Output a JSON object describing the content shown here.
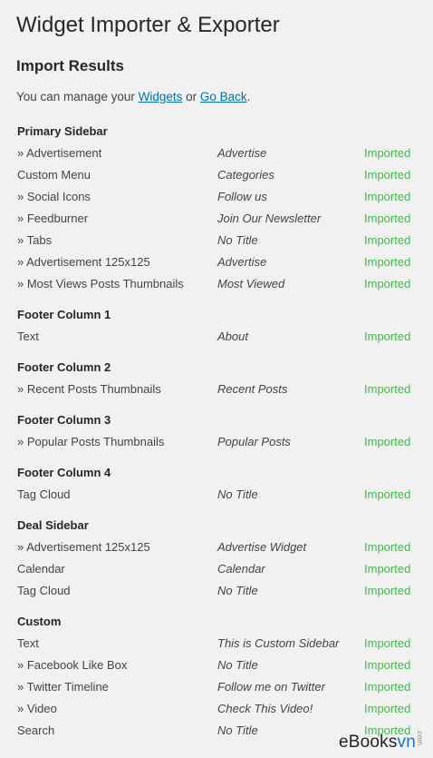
{
  "page": {
    "title": "Widget Importer & Exporter",
    "subtitle": "Import Results",
    "intro_prefix": "You can manage your ",
    "widgets_link": "Widgets",
    "intro_middle": " or ",
    "go_back_link": "Go Back",
    "intro_suffix": "."
  },
  "sections": [
    {
      "title": "Primary Sidebar",
      "rows": [
        {
          "name": "» Advertisement",
          "title": "Advertise",
          "status": "Imported"
        },
        {
          "name": "Custom Menu",
          "title": "Categories",
          "status": "Imported"
        },
        {
          "name": "» Social Icons",
          "title": "Follow us",
          "status": "Imported"
        },
        {
          "name": "» Feedburner",
          "title": "Join Our Newsletter",
          "status": "Imported"
        },
        {
          "name": "» Tabs",
          "title": "No Title",
          "status": "Imported"
        },
        {
          "name": "» Advertisement 125x125",
          "title": "Advertise",
          "status": "Imported"
        },
        {
          "name": "» Most Views Posts Thumbnails",
          "title": "Most Viewed",
          "status": "Imported"
        }
      ]
    },
    {
      "title": "Footer Column 1",
      "rows": [
        {
          "name": "Text",
          "title": "About",
          "status": "Imported"
        }
      ]
    },
    {
      "title": "Footer Column 2",
      "rows": [
        {
          "name": "» Recent Posts Thumbnails",
          "title": "Recent Posts",
          "status": "Imported"
        }
      ]
    },
    {
      "title": "Footer Column 3",
      "rows": [
        {
          "name": "» Popular Posts Thumbnails",
          "title": "Popular Posts",
          "status": "Imported"
        }
      ]
    },
    {
      "title": "Footer Column 4",
      "rows": [
        {
          "name": "Tag Cloud",
          "title": "No Title",
          "status": "Imported"
        }
      ]
    },
    {
      "title": "Deal Sidebar",
      "rows": [
        {
          "name": "» Advertisement 125x125",
          "title": "Advertise Widget",
          "status": "Imported"
        },
        {
          "name": "Calendar",
          "title": "Calendar",
          "status": "Imported"
        },
        {
          "name": "Tag Cloud",
          "title": "No Title",
          "status": "Imported"
        }
      ]
    },
    {
      "title": "Custom",
      "rows": [
        {
          "name": "Text",
          "title": "This is Custom Sidebar",
          "status": "Imported"
        },
        {
          "name": "» Facebook Like Box",
          "title": "No Title",
          "status": "Imported"
        },
        {
          "name": "» Twitter Timeline",
          "title": "Follow me on Twitter",
          "status": "Imported"
        },
        {
          "name": "» Video",
          "title": "Check This Video!",
          "status": "Imported"
        },
        {
          "name": "Search",
          "title": "No Title",
          "status": "Imported"
        }
      ]
    }
  ],
  "watermark": {
    "prefix": "eBooks",
    "vn": "vn",
    "com": ".com"
  },
  "colors": {
    "background": "#f1f1f1",
    "link": "#0073aa",
    "imported": "#46b450",
    "heading": "#23282d"
  }
}
